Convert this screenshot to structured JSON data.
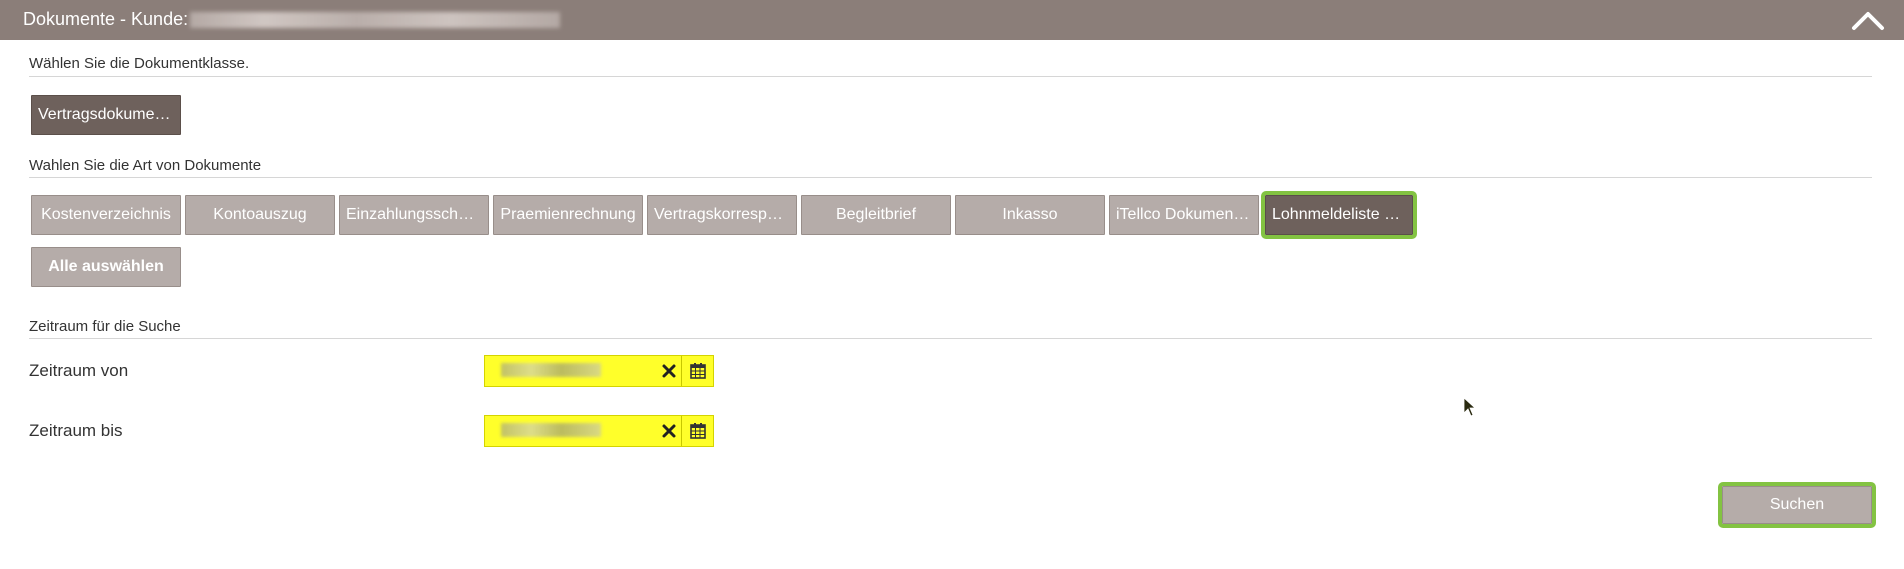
{
  "header": {
    "title": "Dokumente - Kunde:",
    "collapse_icon": "chevron-up-icon"
  },
  "document_class": {
    "label": "Wählen Sie die Dokumentklasse.",
    "options": [
      "Vertragsdokumente"
    ],
    "selected": "Vertragsdokumente"
  },
  "document_type": {
    "label": "Wahlen Sie die Art von Dokumente",
    "options": [
      "Kostenverzeichnis",
      "Kontoauszug",
      "Einzahlungsscheine",
      "Praemienrechnung",
      "Vertragskorrespon...",
      "Begleitbrief",
      "Inkasso",
      "iTellco Dokumente...",
      "Lohnmeldeliste Ve..."
    ],
    "selected": "Lohnmeldeliste Ve...",
    "select_all_label": "Alle auswählen"
  },
  "period": {
    "label": "Zeitraum für die Suche",
    "from_label": "Zeitraum von",
    "to_label": "Zeitraum bis",
    "clear_icon": "close-icon",
    "calendar_icon": "calendar-icon"
  },
  "search": {
    "label": "Suchen"
  },
  "colors": {
    "header": "#8b7e79",
    "button": "#b5aca9",
    "button_selected": "#6e615c",
    "highlight_green": "#83c342",
    "highlight_yellow": "#ffff2a"
  }
}
